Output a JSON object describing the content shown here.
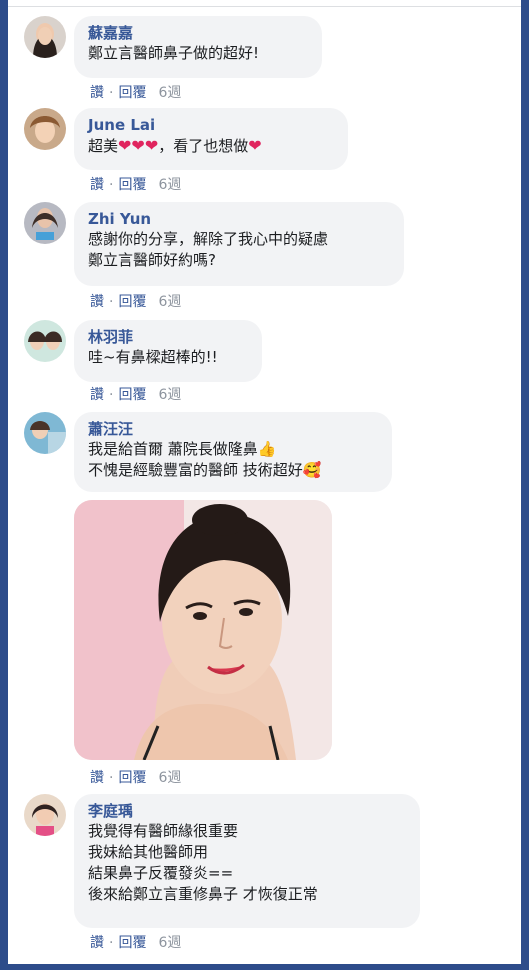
{
  "actions": {
    "like": "讚",
    "reply": "回覆",
    "time": "6週"
  },
  "comments": [
    {
      "author": "蘇嘉嘉",
      "lines": [
        "鄭立言醫師鼻子做的超好!"
      ]
    },
    {
      "author": "June Lai",
      "text_a": "超美",
      "hearts": "❤❤❤",
      "text_b": "，看了也想做",
      "heart_end": "❤"
    },
    {
      "author": "Zhi Yun",
      "lines": [
        "感謝你的分享，解除了我心中的疑慮",
        "鄭立言醫師好約嗎?"
      ]
    },
    {
      "author": "林羽菲",
      "lines": [
        "哇~有鼻樑超棒的!!"
      ]
    },
    {
      "author": "蕭汪汪",
      "lines": [
        "我是給首爾 蕭院長做隆鼻",
        "不愧是經驗豐富的醫師 技術超好"
      ],
      "emoji_1": "👍",
      "emoji_2": "🥰"
    },
    {
      "author": "李庭瑀",
      "lines": [
        "我覺得有醫師緣很重要",
        "我妹給其他醫師用",
        "結果鼻子反覆發炎==",
        "後來給鄭立言重修鼻子 才恢復正常"
      ]
    }
  ]
}
